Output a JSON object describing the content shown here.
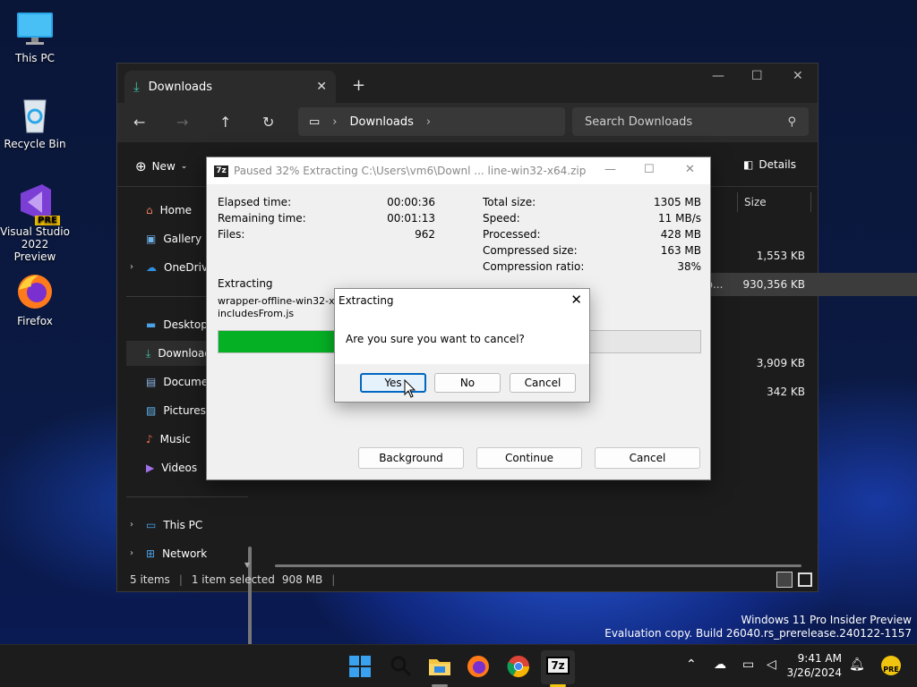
{
  "desktop": {
    "icons": [
      {
        "label": "This PC"
      },
      {
        "label": "Recycle Bin"
      },
      {
        "label_line1": "Visual Studio",
        "label_line2": "2022 Preview",
        "badge": "PRE"
      },
      {
        "label": "Firefox"
      }
    ]
  },
  "explorer": {
    "tab_title": "Downloads",
    "address_segment": "Downloads",
    "search_placeholder": "Search Downloads",
    "new_label": "New",
    "details_label": "Details",
    "column_size": "Size",
    "sizes": [
      "1,553 KB",
      "930,356 KB",
      "3,909 KB",
      "342 KB"
    ],
    "truncated_name": "op...",
    "sidebar": [
      "Home",
      "Gallery",
      "OneDrive",
      "Desktop",
      "Downloads",
      "Documents",
      "Pictures",
      "Music",
      "Videos",
      "This PC",
      "Network"
    ],
    "status": {
      "items": "5 items",
      "selected": "1 item selected",
      "size": "908 MB"
    }
  },
  "zip": {
    "title": "Paused 32% Extracting C:\\Users\\vm6\\Downl ... line-win32-x64.zip",
    "logo": "7z",
    "progress_percent": 32,
    "left_stats": [
      {
        "label": "Elapsed time:",
        "value": "00:00:36"
      },
      {
        "label": "Remaining time:",
        "value": "00:01:13"
      },
      {
        "label": "Files:",
        "value": "962"
      }
    ],
    "right_stats": [
      {
        "label": "Total size:",
        "value": "1305 MB"
      },
      {
        "label": "Speed:",
        "value": "11 MB/s"
      },
      {
        "label": "Processed:",
        "value": "428 MB"
      },
      {
        "label": "Compressed size:",
        "value": "163 MB"
      },
      {
        "label": "Compression ratio:",
        "value": "38%"
      }
    ],
    "extracting_label": "Extracting",
    "file_line1": "wrapper-offline-win32-x64\\ve",
    "file_line2": "includesFrom.js",
    "buttons": {
      "background": "Background",
      "continue": "Continue",
      "cancel": "Cancel"
    }
  },
  "confirm": {
    "title": "Extracting",
    "message": "Are you sure you want to cancel?",
    "yes": "Yes",
    "no": "No",
    "cancel": "Cancel"
  },
  "watermark": {
    "line1": "Windows 11 Pro Insider Preview",
    "line2": "Evaluation copy. Build 26040.rs_prerelease.240122-1157"
  },
  "taskbar": {
    "time": "9:41 AM",
    "date": "3/26/2024",
    "badge": "PRE"
  },
  "colors": {
    "progress": "#06b025",
    "accent": "#0067c0"
  }
}
